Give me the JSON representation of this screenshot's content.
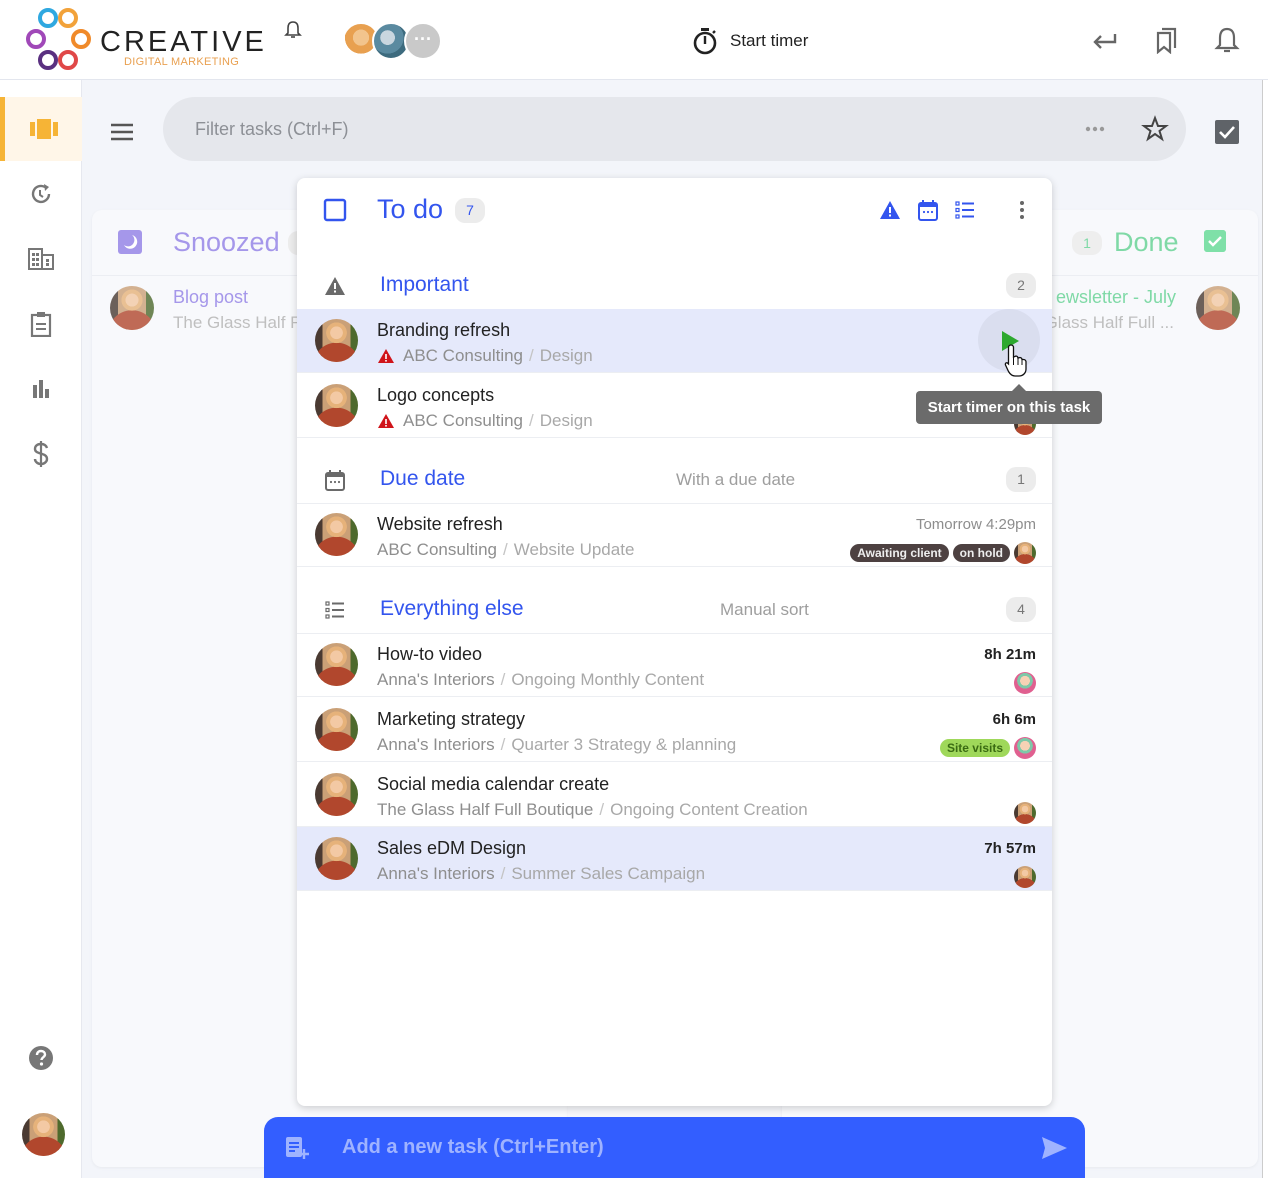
{
  "header": {
    "logo_word": "CREATIVE",
    "logo_sub": "DIGITAL MARKETING",
    "more_users_label": "···",
    "start_timer_label": "Start timer"
  },
  "filter": {
    "placeholder": "Filter tasks (Ctrl+F)",
    "more_label": "···"
  },
  "snoozed": {
    "title": "Snoozed",
    "task_name": "Blog post",
    "task_sub": "The Glass Half F"
  },
  "done": {
    "title": "Done",
    "count": "1",
    "task_name": "ewsletter - July",
    "task_sub": "Glass Half Full ..."
  },
  "todo": {
    "title": "To do",
    "count": "7",
    "groups": [
      {
        "title": "Important",
        "sort": "",
        "count": "2",
        "tasks": [
          {
            "name": "Branding refresh",
            "client": "ABC Consulting",
            "project": "Design",
            "important": true,
            "right": "",
            "tags": []
          },
          {
            "name": "Logo concepts",
            "client": "ABC Consulting",
            "project": "Design",
            "important": true,
            "right": "",
            "tags": []
          }
        ]
      },
      {
        "title": "Due date",
        "sort": "With a due date",
        "count": "1",
        "tasks": [
          {
            "name": "Website refresh",
            "client": "ABC Consulting",
            "project": "Website Update",
            "right": "Tomorrow 4:29pm",
            "tags": [
              "Awaiting client",
              "on hold"
            ]
          }
        ]
      },
      {
        "title": "Everything else",
        "sort": "Manual sort",
        "count": "4",
        "tasks": [
          {
            "name": "How-to video",
            "client": "Anna's Interiors",
            "project": "Ongoing Monthly Content",
            "right": "8h 21m",
            "tags": []
          },
          {
            "name": "Marketing strategy",
            "client": "Anna's Interiors",
            "project": "Quarter 3 Strategy & planning",
            "right": "6h 6m",
            "tags": [
              "Site visits"
            ]
          },
          {
            "name": "Social media calendar create",
            "client": "The Glass Half Full Boutique",
            "project": "Ongoing Content Creation",
            "right": "",
            "tags": []
          },
          {
            "name": "Sales eDM Design",
            "client": "Anna's Interiors",
            "project": "Summer Sales Campaign",
            "right": "7h 57m",
            "tags": []
          }
        ]
      }
    ]
  },
  "tooltip": "Start timer on this task",
  "add_task": {
    "placeholder": "Add a new task (Ctrl+Enter)"
  },
  "colors": {
    "accent": "#3355ee",
    "add_bar": "#335eff",
    "snoozed": "#a597ea",
    "done": "#7fd9a6",
    "play": "#1aa31a",
    "important_warning": "#d0141a",
    "nav_active": "#f6b436"
  }
}
